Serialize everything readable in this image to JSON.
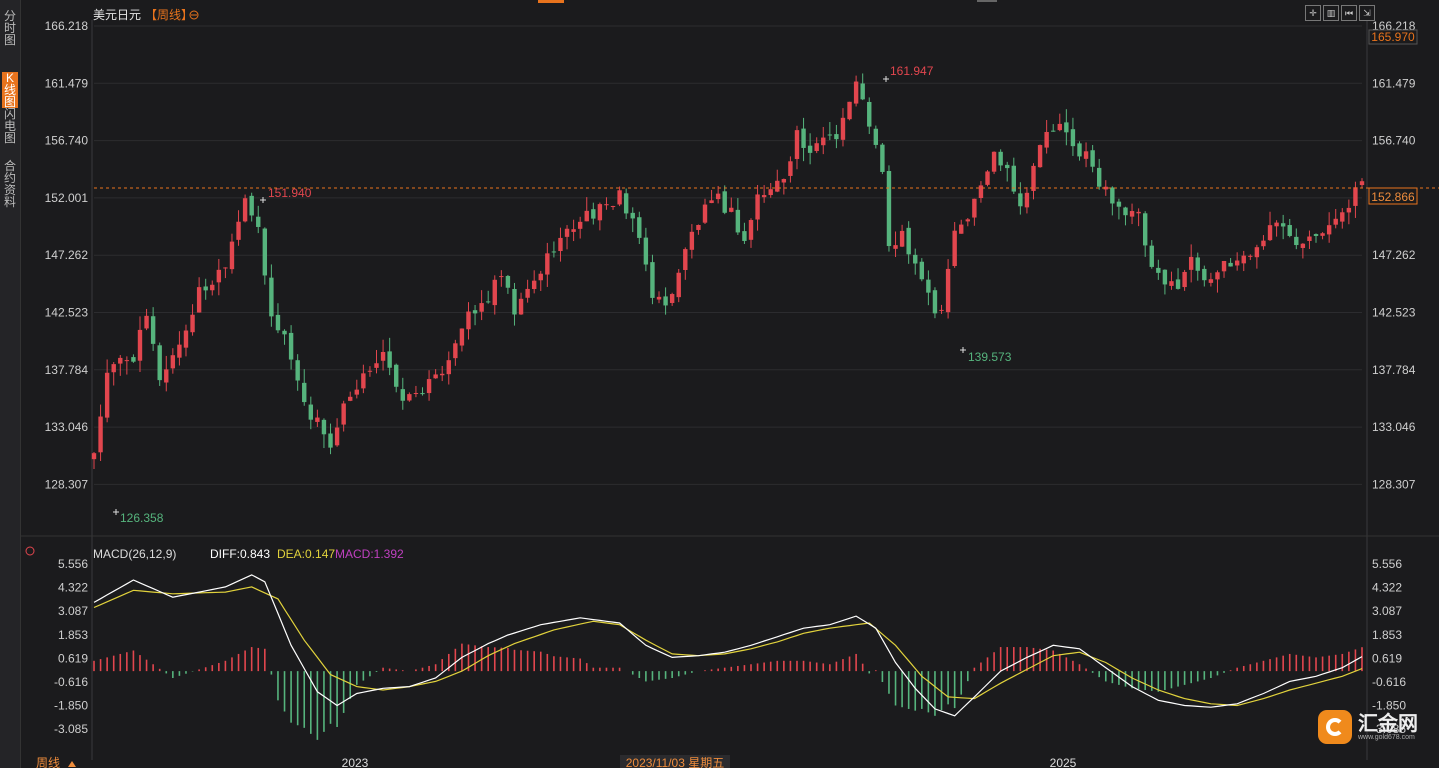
{
  "sidebar": {
    "tabs": [
      {
        "label": "分时图",
        "active": false
      },
      {
        "label": "K线图",
        "active": true
      },
      {
        "label": "闪电图",
        "active": false
      },
      {
        "label": "合约资料",
        "active": false
      }
    ]
  },
  "header": {
    "symbol": "美元日元",
    "period": "【周线】",
    "settings_icon": "circle-plus-icon"
  },
  "toolbar": {
    "buttons": [
      "crosshair-icon",
      "bar-chart-icon",
      "step-back-icon",
      "expand-icon"
    ]
  },
  "price_axis": {
    "top_marker": "165.970",
    "current_price": "152.866",
    "current_price_value": 152.866,
    "ticks": [
      "166.218",
      "161.479",
      "156.740",
      "152.001",
      "147.262",
      "142.523",
      "137.784",
      "133.046",
      "128.307"
    ]
  },
  "annotations": {
    "low_start": "126.358",
    "high_2022": "151.940",
    "high_2024": "161.947",
    "low_2024": "139.573"
  },
  "macd": {
    "header": "MACD(26,12,9)",
    "diff_label": "DIFF:0.843",
    "dea_label": "DEA:0.147",
    "macd_label": "MACD:1.392",
    "ticks": [
      "5.556",
      "4.322",
      "3.087",
      "1.853",
      "0.619",
      "-0.616",
      "-1.850",
      "-3.085"
    ]
  },
  "time_axis": {
    "period_label": "周线",
    "labels": [
      "2023",
      "2023/11/03 星期五",
      "2025"
    ]
  },
  "colors": {
    "up": "#e2464e",
    "down": "#56b47d",
    "diff": "#ffffff",
    "dea": "#e1d23c",
    "macd": "#c040c0",
    "accent": "#e8731d",
    "bg": "#1b1b1d"
  },
  "logo": {
    "name": "汇金网",
    "url": "www.gold678.com"
  },
  "chart_data": {
    "type": "candlestick",
    "title": "美元日元 周线",
    "ylim": [
      124.5,
      168
    ],
    "key_points": [
      {
        "label": "low",
        "value": 126.358
      },
      {
        "label": "high",
        "value": 151.94
      },
      {
        "label": "high",
        "value": 161.947
      },
      {
        "label": "low",
        "value": 139.573
      }
    ],
    "close_path": [
      [
        0,
        127.0
      ],
      [
        2,
        134
      ],
      [
        4,
        135.6
      ],
      [
        6,
        136
      ],
      [
        8,
        139.5
      ],
      [
        10,
        134
      ],
      [
        12,
        136
      ],
      [
        14,
        138.5
      ],
      [
        16,
        142
      ],
      [
        18,
        143
      ],
      [
        20,
        145
      ],
      [
        22,
        149
      ],
      [
        23,
        151.3
      ],
      [
        25,
        147.5
      ],
      [
        27,
        139.5
      ],
      [
        29,
        138
      ],
      [
        31,
        133.5
      ],
      [
        33,
        130.5
      ],
      [
        35,
        129
      ],
      [
        36,
        127.5
      ],
      [
        38,
        131
      ],
      [
        40,
        132.5
      ],
      [
        42,
        135
      ],
      [
        44,
        136.5
      ],
      [
        46,
        132.5
      ],
      [
        48,
        132
      ],
      [
        50,
        133
      ],
      [
        52,
        133.6
      ],
      [
        54,
        136
      ],
      [
        56,
        139
      ],
      [
        58,
        140
      ],
      [
        60,
        141.5
      ],
      [
        62,
        143.5
      ],
      [
        64,
        140
      ],
      [
        66,
        142
      ],
      [
        68,
        144
      ],
      [
        70,
        146.5
      ],
      [
        72,
        147.5
      ],
      [
        74,
        149
      ],
      [
        76,
        149.5
      ],
      [
        78,
        149.8
      ],
      [
        80,
        151.5
      ],
      [
        81,
        149.5
      ],
      [
        83,
        147
      ],
      [
        85,
        142
      ],
      [
        87,
        140.5
      ],
      [
        89,
        144
      ],
      [
        91,
        147.5
      ],
      [
        93,
        149.6
      ],
      [
        95,
        150.6
      ],
      [
        97,
        149.5
      ],
      [
        99,
        146.8
      ],
      [
        101,
        151
      ],
      [
        103,
        151.6
      ],
      [
        105,
        153
      ],
      [
        107,
        157
      ],
      [
        109,
        154.5
      ],
      [
        111,
        156.8
      ],
      [
        113,
        157
      ],
      [
        115,
        160
      ],
      [
        116,
        161.6
      ],
      [
        118,
        158
      ],
      [
        120,
        153
      ],
      [
        121,
        146
      ],
      [
        123,
        147.5
      ],
      [
        125,
        144
      ],
      [
        127,
        142.5
      ],
      [
        128,
        140
      ],
      [
        129,
        141
      ],
      [
        131,
        148
      ],
      [
        133,
        149
      ],
      [
        135,
        152
      ],
      [
        137,
        155
      ],
      [
        139,
        154
      ],
      [
        141,
        150
      ],
      [
        143,
        154
      ],
      [
        145,
        157
      ],
      [
        147,
        157.5
      ],
      [
        149,
        155.6
      ],
      [
        151,
        155
      ],
      [
        153,
        152
      ],
      [
        155,
        151
      ],
      [
        157,
        149.5
      ],
      [
        159,
        149
      ],
      [
        161,
        144
      ],
      [
        163,
        142.5
      ],
      [
        165,
        143
      ],
      [
        167,
        145
      ],
      [
        169,
        143.5
      ],
      [
        171,
        144
      ],
      [
        173,
        144.5
      ],
      [
        175,
        145.5
      ],
      [
        177,
        146
      ],
      [
        179,
        148.5
      ],
      [
        181,
        148
      ],
      [
        183,
        147
      ],
      [
        185,
        147.5
      ],
      [
        187,
        148.2
      ],
      [
        189,
        149.3
      ],
      [
        191,
        149.5
      ],
      [
        192,
        152
      ],
      [
        193,
        152.866
      ]
    ],
    "macd": {
      "ylim": [
        -3.6,
        6.0
      ],
      "diff": [
        [
          0,
          4.0
        ],
        [
          6,
          5.3
        ],
        [
          12,
          4.3
        ],
        [
          20,
          4.9
        ],
        [
          24,
          5.6
        ],
        [
          26,
          5.2
        ],
        [
          30,
          1.5
        ],
        [
          34,
          -1.2
        ],
        [
          37,
          -2.0
        ],
        [
          40,
          -1.3
        ],
        [
          44,
          -1.0
        ],
        [
          48,
          -0.9
        ],
        [
          52,
          -0.4
        ],
        [
          56,
          0.8
        ],
        [
          60,
          1.6
        ],
        [
          63,
          2.1
        ],
        [
          68,
          2.7
        ],
        [
          74,
          3.1
        ],
        [
          80,
          2.8
        ],
        [
          84,
          1.5
        ],
        [
          88,
          0.8
        ],
        [
          92,
          0.9
        ],
        [
          96,
          1.1
        ],
        [
          100,
          1.5
        ],
        [
          104,
          2.0
        ],
        [
          108,
          2.5
        ],
        [
          112,
          2.7
        ],
        [
          116,
          3.2
        ],
        [
          119,
          2.5
        ],
        [
          122,
          0.5
        ],
        [
          125,
          -1.0
        ],
        [
          128,
          -2.2
        ],
        [
          131,
          -2.6
        ],
        [
          134,
          -1.5
        ],
        [
          138,
          0.0
        ],
        [
          142,
          0.8
        ],
        [
          146,
          1.5
        ],
        [
          150,
          1.3
        ],
        [
          154,
          0.2
        ],
        [
          158,
          -0.9
        ],
        [
          162,
          -1.7
        ],
        [
          166,
          -2.0
        ],
        [
          170,
          -2.1
        ],
        [
          174,
          -1.9
        ],
        [
          178,
          -1.3
        ],
        [
          182,
          -0.6
        ],
        [
          186,
          -0.3
        ],
        [
          190,
          0.2
        ],
        [
          193,
          0.843
        ]
      ],
      "dea": [
        [
          0,
          3.7
        ],
        [
          6,
          4.7
        ],
        [
          12,
          4.5
        ],
        [
          20,
          4.6
        ],
        [
          24,
          4.9
        ],
        [
          28,
          4.2
        ],
        [
          32,
          1.8
        ],
        [
          36,
          -0.2
        ],
        [
          40,
          -0.9
        ],
        [
          44,
          -1.1
        ],
        [
          48,
          -0.9
        ],
        [
          52,
          -0.6
        ],
        [
          56,
          0.0
        ],
        [
          60,
          0.9
        ],
        [
          64,
          1.6
        ],
        [
          70,
          2.4
        ],
        [
          76,
          2.9
        ],
        [
          80,
          2.7
        ],
        [
          84,
          1.8
        ],
        [
          88,
          1.0
        ],
        [
          92,
          0.9
        ],
        [
          96,
          1.0
        ],
        [
          100,
          1.3
        ],
        [
          104,
          1.7
        ],
        [
          108,
          2.2
        ],
        [
          112,
          2.5
        ],
        [
          118,
          2.8
        ],
        [
          122,
          1.5
        ],
        [
          126,
          -0.3
        ],
        [
          130,
          -1.5
        ],
        [
          134,
          -1.6
        ],
        [
          138,
          -0.7
        ],
        [
          142,
          0.1
        ],
        [
          146,
          0.9
        ],
        [
          150,
          1.1
        ],
        [
          154,
          0.5
        ],
        [
          158,
          -0.4
        ],
        [
          162,
          -1.1
        ],
        [
          166,
          -1.6
        ],
        [
          170,
          -1.9
        ],
        [
          174,
          -2.0
        ],
        [
          178,
          -1.6
        ],
        [
          182,
          -1.1
        ],
        [
          186,
          -0.7
        ],
        [
          190,
          -0.3
        ],
        [
          193,
          0.147
        ]
      ]
    }
  }
}
